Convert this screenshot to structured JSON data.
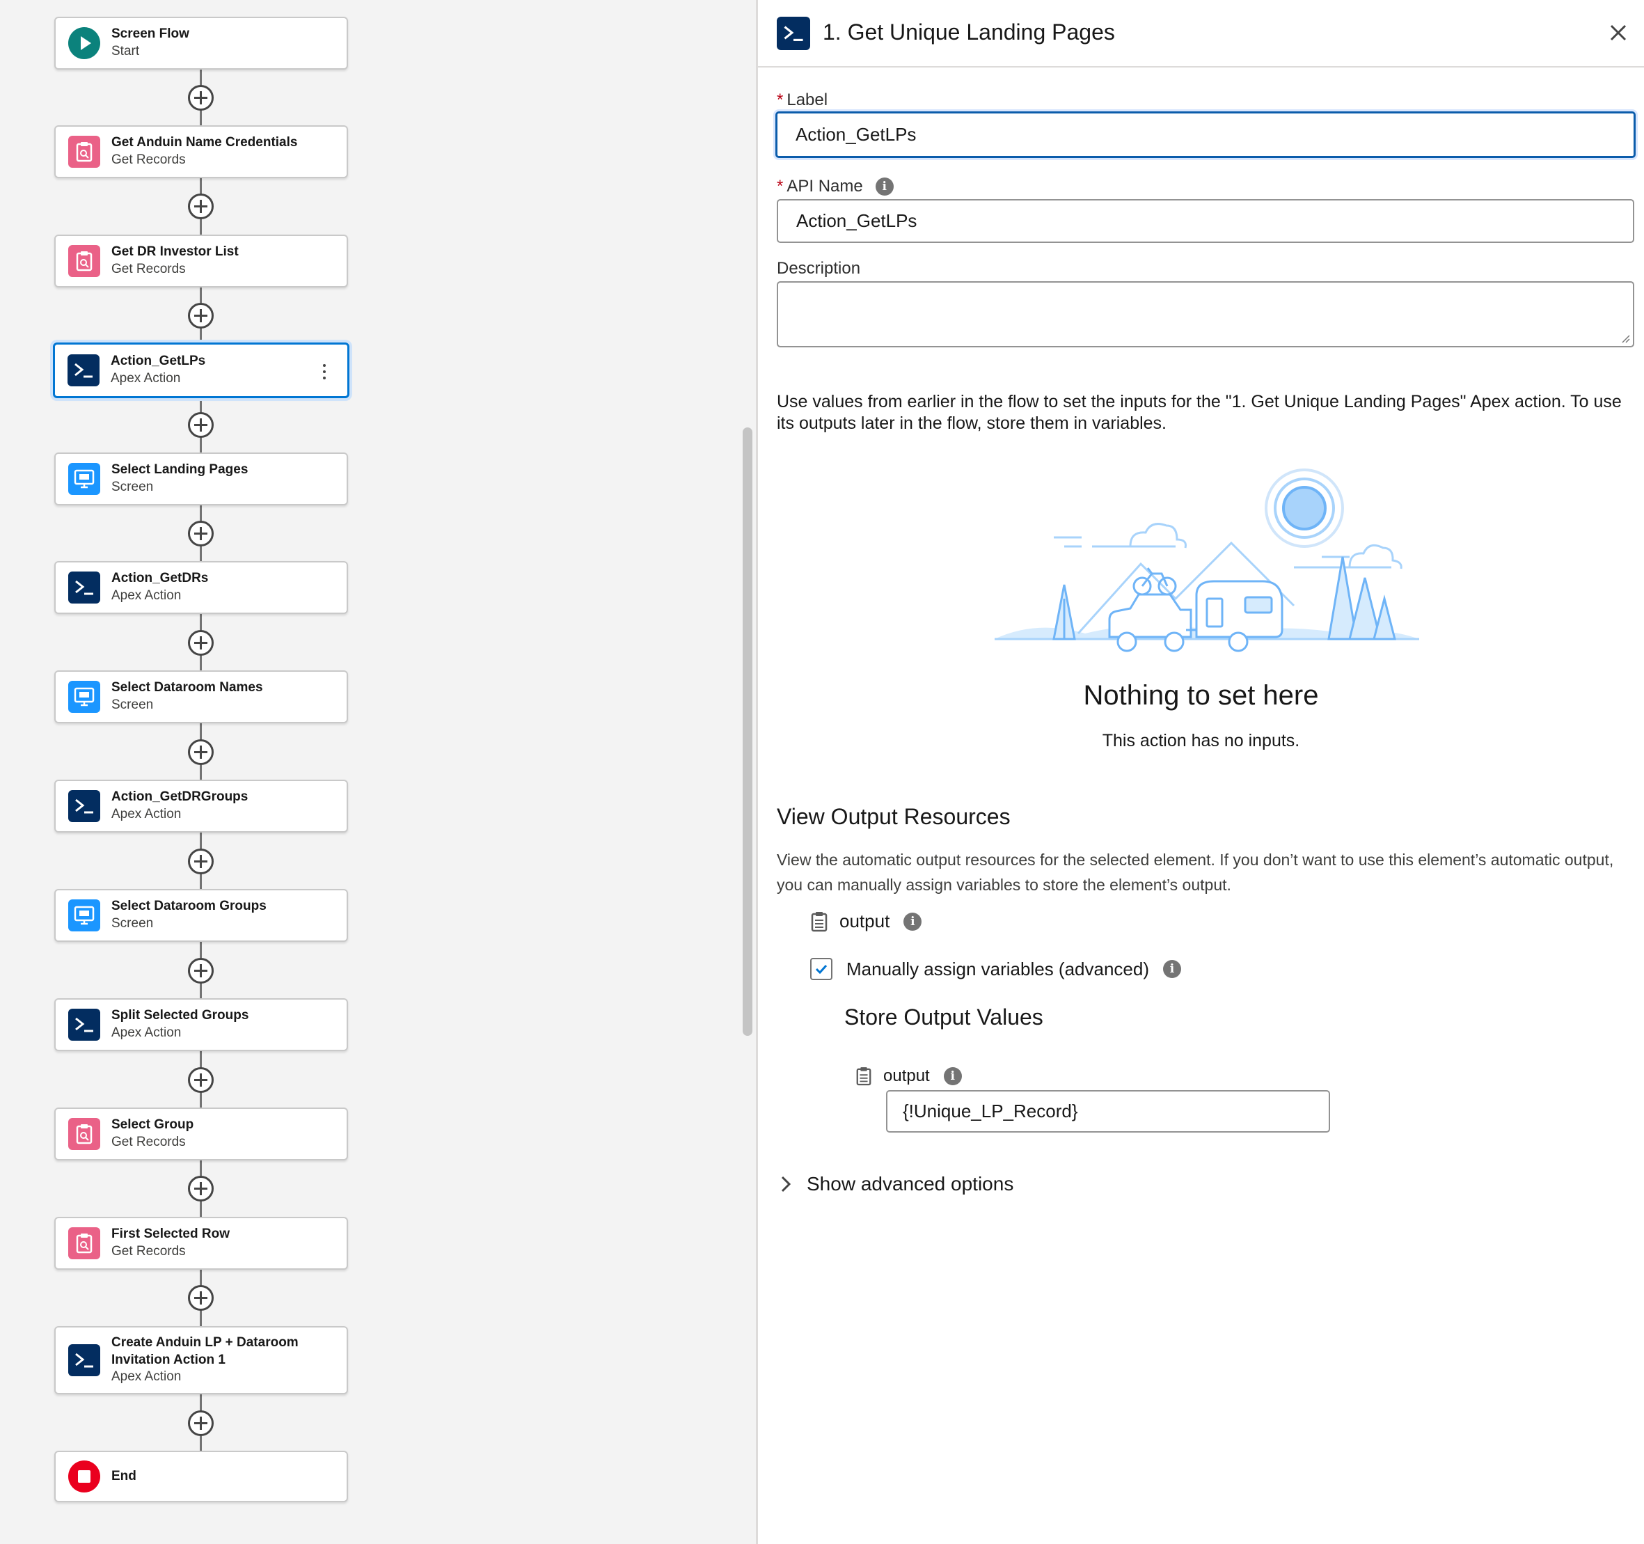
{
  "canvas": {
    "nodes": [
      {
        "title": "Screen Flow",
        "subtitle": "Start",
        "icon": "play-icon"
      },
      {
        "title": "Get Anduin Name Credentials",
        "subtitle": "Get Records",
        "icon": "get-records-icon"
      },
      {
        "title": "Get DR Investor List",
        "subtitle": "Get Records",
        "icon": "get-records-icon"
      },
      {
        "title": "Action_GetLPs",
        "subtitle": "Apex Action",
        "icon": "apex-action-icon",
        "selected": true
      },
      {
        "title": "Select Landing Pages",
        "subtitle": "Screen",
        "icon": "screen-icon"
      },
      {
        "title": "Action_GetDRs",
        "subtitle": "Apex Action",
        "icon": "apex-action-icon"
      },
      {
        "title": "Select Dataroom Names",
        "subtitle": "Screen",
        "icon": "screen-icon"
      },
      {
        "title": "Action_GetDRGroups",
        "subtitle": "Apex Action",
        "icon": "apex-action-icon"
      },
      {
        "title": "Select Dataroom Groups",
        "subtitle": "Screen",
        "icon": "screen-icon"
      },
      {
        "title": "Split Selected Groups",
        "subtitle": "Apex Action",
        "icon": "apex-action-icon"
      },
      {
        "title": "Select Group",
        "subtitle": "Get Records",
        "icon": "get-records-icon"
      },
      {
        "title": "First Selected Row",
        "subtitle": "Get Records",
        "icon": "get-records-icon"
      },
      {
        "title": "Create Anduin LP + Dataroom",
        "title2": "Invitation Action 1",
        "subtitle": "Apex Action",
        "icon": "apex-action-icon"
      },
      {
        "title": "End",
        "subtitle": "",
        "icon": "stop-icon"
      }
    ]
  },
  "panel": {
    "title": "1. Get Unique Landing Pages",
    "label_field": {
      "label": "Label",
      "required_mark": "*",
      "value": "Action_GetLPs"
    },
    "api_field": {
      "label": "API Name",
      "required_mark": "*",
      "value": "Action_GetLPs"
    },
    "description_field": {
      "label": "Description",
      "value": ""
    },
    "intro_text": "Use values from earlier in the flow to set the inputs for the \"1. Get Unique Landing Pages\" Apex action. To use its outputs later in the flow, store them in variables.",
    "empty_state": {
      "title": "Nothing to set here",
      "subtitle": "This action has no inputs."
    },
    "output_section": {
      "heading": "View Output Resources",
      "description": "View the automatic output resources for the selected element. If you don’t want to use this element’s automatic output, you can manually assign variables to store the element’s output.",
      "resource_label": "output",
      "manual_assign_label": "Manually assign variables (advanced)",
      "manual_assign_checked": true,
      "store_heading": "Store Output Values",
      "store_output_label": "output",
      "store_output_value": "{!Unique_LP_Record}"
    },
    "advanced_label": "Show advanced options",
    "info_glyph": "i"
  },
  "colors": {
    "apex": "#032d60",
    "get_records": "#ea6187",
    "screen": "#1b96ff",
    "start": "#0b827c",
    "end": "#ea001e",
    "focus": "#0b5cab"
  }
}
